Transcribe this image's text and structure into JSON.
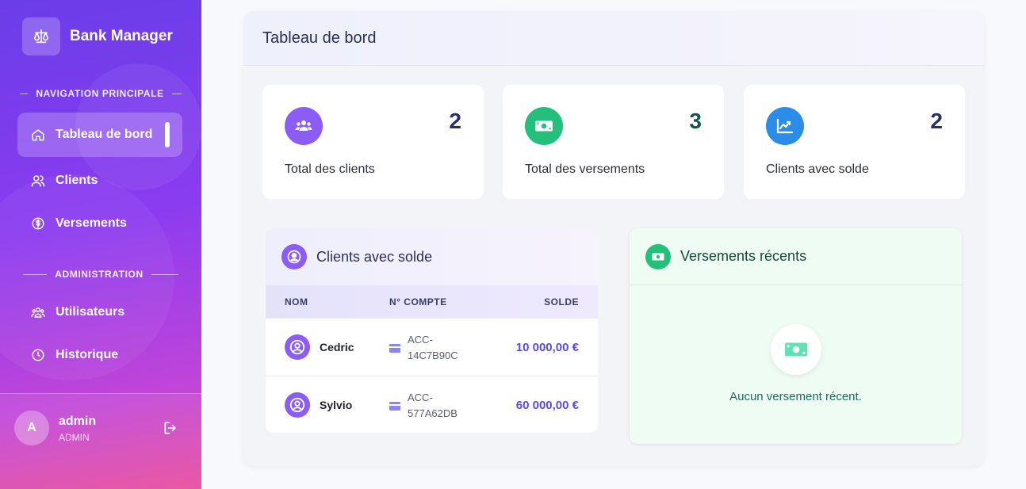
{
  "app": {
    "title": "Bank Manager"
  },
  "sidebar": {
    "sections": [
      {
        "label": "NAVIGATION PRINCIPALE"
      },
      {
        "label": "ADMINISTRATION"
      }
    ],
    "items": [
      {
        "label": "Tableau de bord",
        "icon": "home-icon",
        "active": true
      },
      {
        "label": "Clients",
        "icon": "users-icon"
      },
      {
        "label": "Versements",
        "icon": "dollar-circle-icon"
      },
      {
        "label": "Utilisateurs",
        "icon": "user-group-icon"
      },
      {
        "label": "Historique",
        "icon": "clock-icon"
      }
    ],
    "user": {
      "initial": "A",
      "name": "admin",
      "role": "ADMIN",
      "logout_icon": "logout-icon"
    }
  },
  "page": {
    "title": "Tableau de bord"
  },
  "stats": [
    {
      "value": "2",
      "label": "Total des clients",
      "icon": "users-icon",
      "color": "#8b5cf6",
      "value_color": "#2b2d6b"
    },
    {
      "value": "3",
      "label": "Total des versements",
      "icon": "money-icon",
      "color": "#22c07a",
      "value_color": "#0f5a46"
    },
    {
      "value": "2",
      "label": "Clients avec solde",
      "icon": "chart-up-icon",
      "color": "#2b8de8",
      "value_color": "#2b2d6b"
    }
  ],
  "clients_panel": {
    "title": "Clients avec solde",
    "columns": [
      "NOM",
      "N° COMPTE",
      "SOLDE"
    ],
    "rows": [
      {
        "name": "Cedric",
        "account_line1": "ACC-",
        "account_line2": "14C7B90C",
        "balance": "10 000,00 €"
      },
      {
        "name": "Sylvio",
        "account_line1": "ACC-",
        "account_line2": "577A62DB",
        "balance": "60 000,00 €"
      }
    ]
  },
  "versements_panel": {
    "title": "Versements récents",
    "empty_message": "Aucun versement récent."
  },
  "colors": {
    "accent": "#8b5cf6",
    "green": "#22c07a",
    "blue": "#2b8de8",
    "balance": "#5b4be6"
  }
}
